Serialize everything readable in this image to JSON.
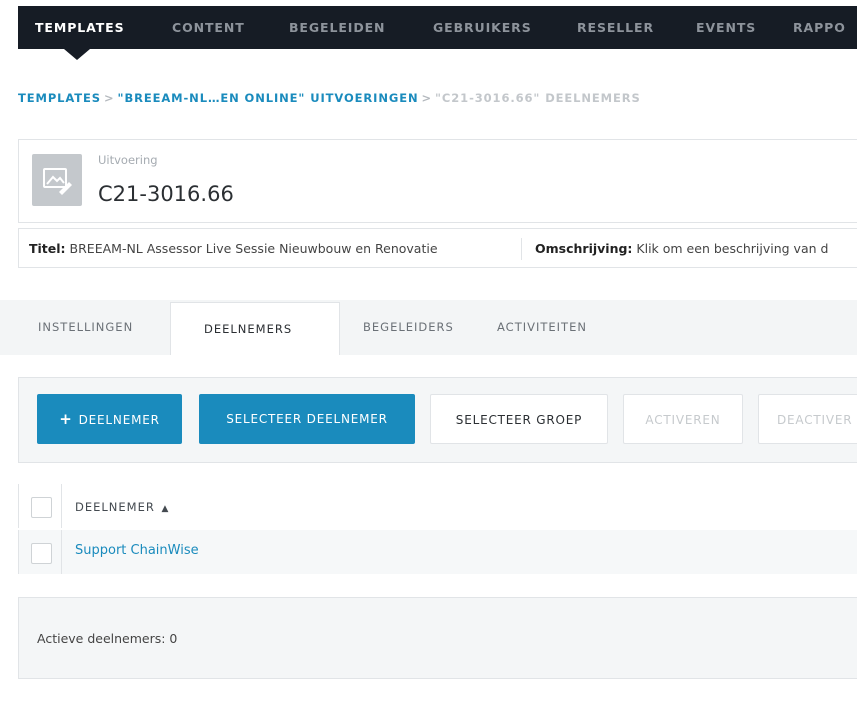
{
  "nav": {
    "items": [
      {
        "label": "TEMPLATES",
        "active": true
      },
      {
        "label": "CONTENT",
        "active": false
      },
      {
        "label": "BEGELEIDEN",
        "active": false
      },
      {
        "label": "GEBRUIKERS",
        "active": false
      },
      {
        "label": "RESELLER",
        "active": false
      },
      {
        "label": "EVENTS",
        "active": false
      },
      {
        "label": "RAPPO",
        "active": false
      }
    ]
  },
  "breadcrumb": {
    "items": [
      "TEMPLATES",
      "\"BREEAM-NL…EN ONLINE\" UITVOERINGEN",
      "\"C21-3016.66\" DEELNEMERS"
    ],
    "separator": ">"
  },
  "record": {
    "kind_label": "Uitvoering",
    "title": "C21-3016.66",
    "thumbnail_icon": "image-edit-icon"
  },
  "info": {
    "title_label": "Titel:",
    "title_value": "BREEAM-NL Assessor Live Sessie Nieuwbouw en Renovatie",
    "description_label": "Omschrijving:",
    "description_value": "Klik om een beschrijving van d"
  },
  "tabs": {
    "items": [
      "INSTELLINGEN",
      "DEELNEMERS",
      "BEGELEIDERS",
      "ACTIVITEITEN"
    ],
    "active": "DEELNEMERS"
  },
  "toolbar": {
    "add_label": "DEELNEMER",
    "add_icon": "plus-icon",
    "select_participant_label": "SELECTEER DEELNEMER",
    "select_group_label": "SELECTEER GROEP",
    "activate_label": "ACTIVEREN",
    "deactivate_label": "DEACTIVER"
  },
  "table": {
    "column_header": "DEELNEMER",
    "sort_icon": "sort-ascending-icon",
    "rows": [
      {
        "name": "Support ChainWise"
      }
    ]
  },
  "footer": {
    "active_count_text": "Actieve deelnemers: 0"
  },
  "colors": {
    "nav_bg": "#161c25",
    "accent": "#1a8bbd",
    "panel_bg": "#f4f6f7"
  }
}
